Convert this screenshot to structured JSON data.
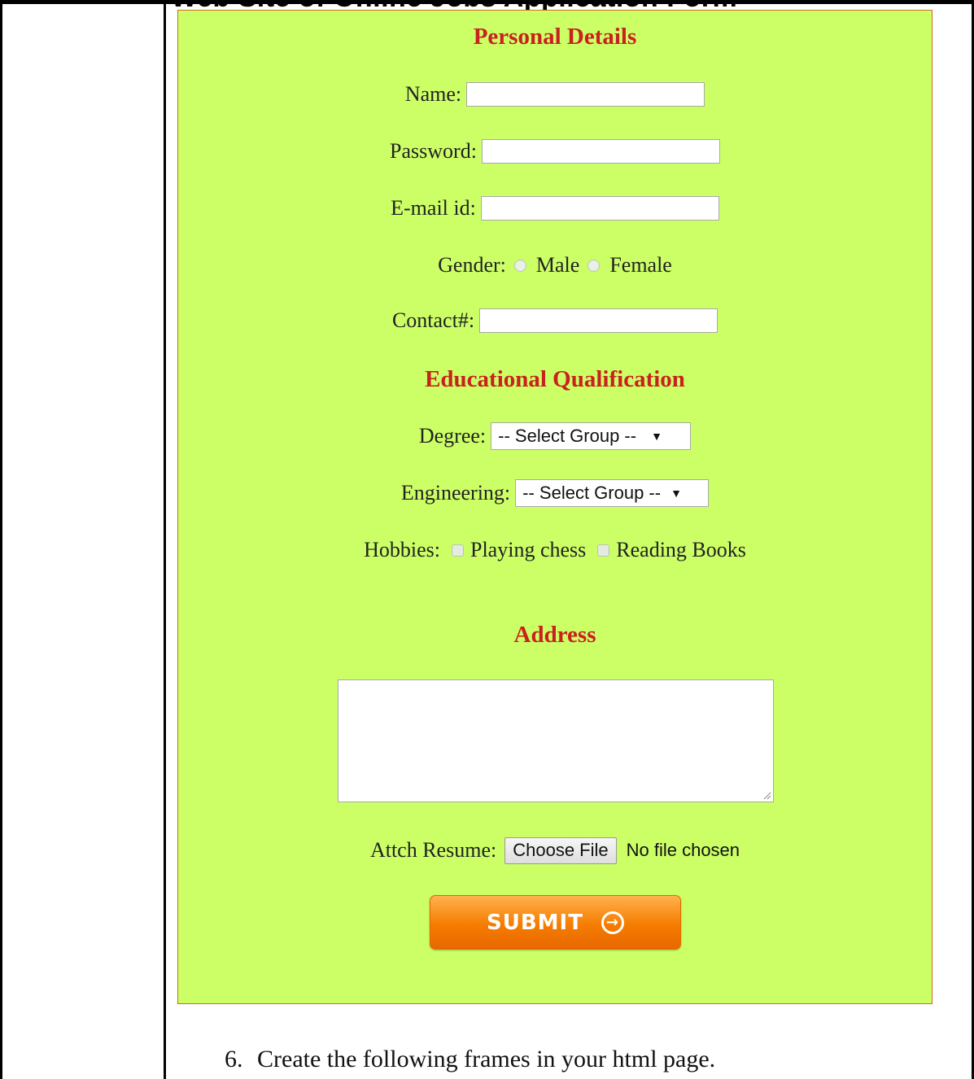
{
  "page": {
    "cut_heading": "Web Site of Online Jobs Application Form",
    "bottom_instruction_number": "6.",
    "bottom_instruction_text": "Create the following frames in your html page."
  },
  "form": {
    "personal_title": "Personal Details",
    "name_label": "Name:",
    "password_label": "Password:",
    "email_label": "E-mail id:",
    "gender_label": "Gender:",
    "gender_options": [
      "Male",
      "Female"
    ],
    "contact_label": "Contact#:",
    "education_title": "Educational Qualification",
    "degree_label": "Degree:",
    "degree_selected": "-- Select Group --",
    "engineering_label": "Engineering:",
    "engineering_selected": "-- Select Group --",
    "hobbies_label": "Hobbies:",
    "hobbies_options": [
      "Playing chess",
      "Reading Books"
    ],
    "address_title": "Address",
    "resume_label": "Attch Resume:",
    "choose_file_label": "Choose File",
    "file_status": "No file chosen",
    "submit_label": "SUBMIT"
  },
  "colors": {
    "panel_bg": "#ccff66",
    "section_title": "#c9211e",
    "submit_orange": "#f57c00"
  }
}
